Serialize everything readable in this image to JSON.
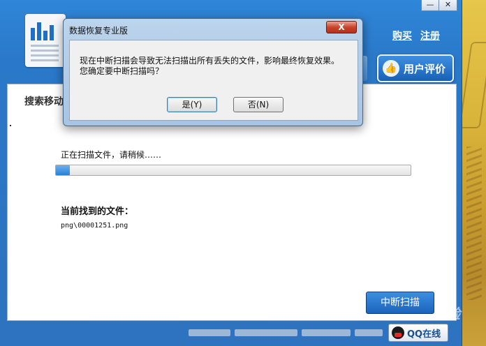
{
  "window": {
    "minimize_symbol": "—",
    "close_symbol": "✕"
  },
  "header": {
    "links": [
      "购买",
      "注册"
    ],
    "rate_button_label": "用户评价",
    "rate_icon": "thumbs-up-icon"
  },
  "main": {
    "section_title": "搜索移动",
    "scan_status": "正在扫描文件，请稍候……",
    "progress_fraction": 0.04,
    "found_label": "当前找到的文件：",
    "found_file": "png\\00001251.png",
    "stop_button_label": "中断扫描"
  },
  "footer": {
    "qq_button_label": "QQ在线",
    "watermark": "Baidu 经验"
  },
  "dialog": {
    "title": "数据恢复专业版",
    "close_symbol": "X",
    "message_line1": "现在中断扫描会导致无法扫描出所有丢失的文件，影响最终恢复效果。",
    "message_line2": "您确定要中断扫描吗？",
    "yes_label": "是(Y)",
    "no_label": "否(N)"
  },
  "colors": {
    "app_blue": "#2d73bf",
    "dialog_frame": "#bcd4ec",
    "close_red": "#c9442c"
  }
}
